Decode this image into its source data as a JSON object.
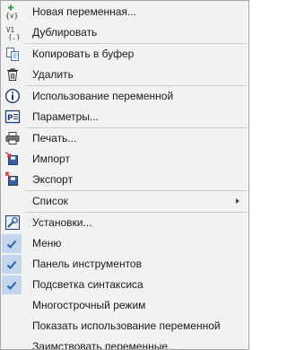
{
  "menu": {
    "new_variable": "Новая переменная...",
    "duplicate": "Дублировать",
    "copy_to_buffer": "Копировать в буфер",
    "delete": "Удалить",
    "variable_usage": "Использование переменной",
    "parameters": "Параметры...",
    "print": "Печать...",
    "import": "Импорт",
    "export": "Экспорт",
    "list": "Список",
    "settings": "Установки...",
    "menu_toggle": "Меню",
    "toolbar_toggle": "Панель инструментов",
    "syntax_highlight": "Подсветка синтаксиса",
    "multiline_mode": "Многострочный режим",
    "show_variable_usage": "Показать использование переменной",
    "borrow_variables": "Заимствовать переменные..."
  },
  "checked": {
    "menu_toggle": true,
    "toolbar_toggle": true,
    "syntax_highlight": true
  },
  "icons": {
    "new_variable": "new-variable-icon",
    "duplicate": "duplicate-icon",
    "copy_to_buffer": "copy-icon",
    "delete": "trash-icon",
    "variable_usage": "info-icon",
    "parameters": "parameters-icon",
    "print": "printer-icon",
    "import": "import-icon",
    "export": "export-icon",
    "settings": "settings-icon"
  },
  "colors": {
    "check_highlight": "#c4d6ee",
    "check_mark": "#2b62a8",
    "separator": "#d0d0d0"
  }
}
